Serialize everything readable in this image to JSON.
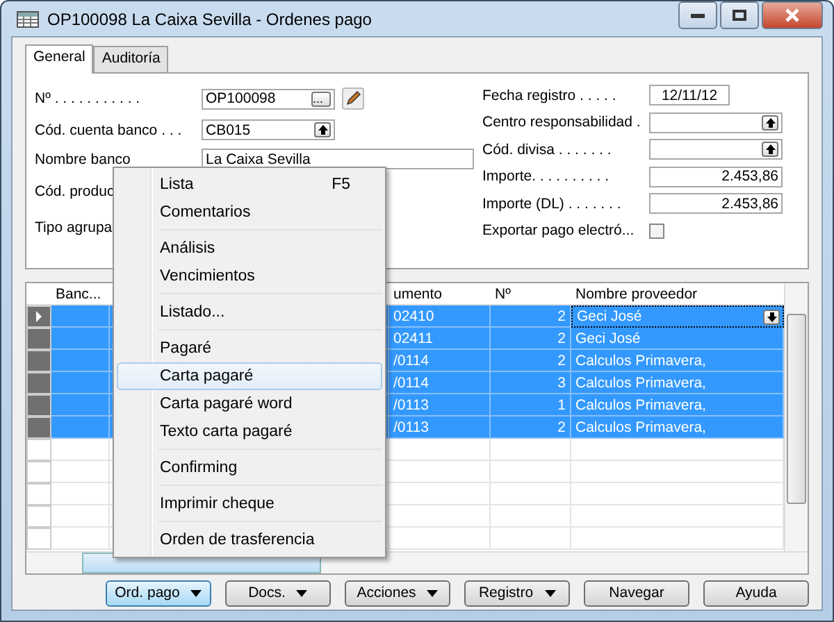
{
  "window": {
    "title": "OP100098 La Caixa Sevilla - Ordenes pago"
  },
  "tabs": [
    {
      "label": "General",
      "selected": true
    },
    {
      "label": "Auditoría",
      "selected": false
    }
  ],
  "form": {
    "left": [
      {
        "kind": "lookup",
        "label": "Nº . . . . . . . . . . .",
        "value": "OP100098",
        "button": "..."
      },
      {
        "kind": "dropdown",
        "label": "Cód. cuenta banco . . .",
        "value": "CB015"
      },
      {
        "kind": "text",
        "label": "Nombre banco",
        "value": "La Caixa Sevilla"
      },
      {
        "kind": "label",
        "label": "Cód. produc"
      },
      {
        "kind": "label",
        "label": "Tipo agrupa"
      }
    ],
    "right": [
      {
        "kind": "date",
        "label": "Fecha registro . . . . .",
        "value": "12/11/12"
      },
      {
        "kind": "dropdown",
        "label": "Centro responsabilidad ."
      },
      {
        "kind": "dropdown",
        "label": "Cód. divisa . . . . . . ."
      },
      {
        "kind": "number",
        "label": "Importe. . . . . . . . . .",
        "value": "2.453,86"
      },
      {
        "kind": "number",
        "label": "Importe (DL) . . . . . . .",
        "value": "2.453,86"
      },
      {
        "kind": "checkbox",
        "label": "Exportar pago electró...",
        "checked": false
      }
    ]
  },
  "grid": {
    "columns": [
      "Banc...",
      "umento",
      "Nº",
      "Nombre proveedor"
    ],
    "rows": [
      {
        "column_2": "02410",
        "number": "2",
        "supplier": "Geci José",
        "selected": true,
        "current": true
      },
      {
        "column_2": "02411",
        "number": "2",
        "supplier": "Geci José",
        "selected": true,
        "current": false
      },
      {
        "column_2": "/0114",
        "number": "2",
        "supplier": "Calculos Primavera,",
        "selected": true,
        "current": false
      },
      {
        "column_2": "/0114",
        "number": "3",
        "supplier": "Calculos Primavera,",
        "selected": true,
        "current": false
      },
      {
        "column_2": "/0113",
        "number": "1",
        "supplier": "Calculos Primavera,",
        "selected": true,
        "current": false
      },
      {
        "column_2": "/0113",
        "number": "2",
        "supplier": "Calculos Primavera,",
        "selected": true,
        "current": false
      }
    ]
  },
  "menu": {
    "groups": [
      [
        {
          "label": "Lista",
          "shortcut": "F5",
          "highlighted": false
        },
        {
          "label": "Comentarios",
          "highlighted": false
        }
      ],
      [
        {
          "label": "Análisis",
          "highlighted": false
        },
        {
          "label": "Vencimientos",
          "highlighted": false
        }
      ],
      [
        {
          "label": "Listado...",
          "highlighted": false
        }
      ],
      [
        {
          "label": "Pagaré",
          "highlighted": false
        },
        {
          "label": "Carta pagaré",
          "highlighted": true
        },
        {
          "label": "Carta pagaré word",
          "highlighted": false
        },
        {
          "label": "Texto carta pagaré",
          "highlighted": false
        }
      ],
      [
        {
          "label": "Confirming",
          "highlighted": false
        }
      ],
      [
        {
          "label": "Imprimir cheque",
          "highlighted": false
        }
      ],
      [
        {
          "label": "Orden de trasferencia",
          "highlighted": false
        }
      ]
    ]
  },
  "buttons": [
    {
      "label": "Ord. pago",
      "kind": "dropdown",
      "pressed": true
    },
    {
      "label": "Docs.",
      "kind": "dropdown",
      "pressed": false
    },
    {
      "label": "Acciones",
      "kind": "dropdown",
      "pressed": false
    },
    {
      "label": "Registro",
      "kind": "dropdown",
      "pressed": false
    },
    {
      "label": "Navegar",
      "kind": "plain",
      "pressed": false
    },
    {
      "label": "Ayuda",
      "kind": "plain",
      "pressed": false
    }
  ]
}
